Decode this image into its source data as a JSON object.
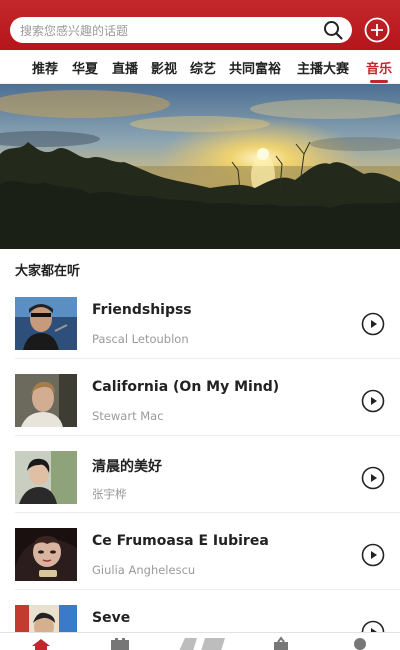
{
  "search": {
    "placeholder": "搜索您感兴趣的话题"
  },
  "tabs": [
    {
      "label": "推荐"
    },
    {
      "label": "华夏"
    },
    {
      "label": "直播"
    },
    {
      "label": "影视"
    },
    {
      "label": "综艺"
    },
    {
      "label": "共同富裕"
    },
    {
      "label": "主播大赛"
    },
    {
      "label": "音乐"
    }
  ],
  "active_tab": "音乐",
  "section": {
    "title": "大家都在听"
  },
  "songs": [
    {
      "title": "Friendshipss",
      "artist": "Pascal Letoublon"
    },
    {
      "title": "California (On My Mind)",
      "artist": "Stewart Mac"
    },
    {
      "title": "清晨的美好",
      "artist": "张宇桦"
    },
    {
      "title": "Ce Frumoasa E Iubirea",
      "artist": "Giulia Anghelescu"
    },
    {
      "title": "Seve",
      "artist": ""
    }
  ],
  "colors": {
    "brand": "#c3272b",
    "muted": "#9a9a9a"
  },
  "icons": {
    "search": "search-icon",
    "add": "plus-circle-icon",
    "play": "play-circle-icon"
  }
}
